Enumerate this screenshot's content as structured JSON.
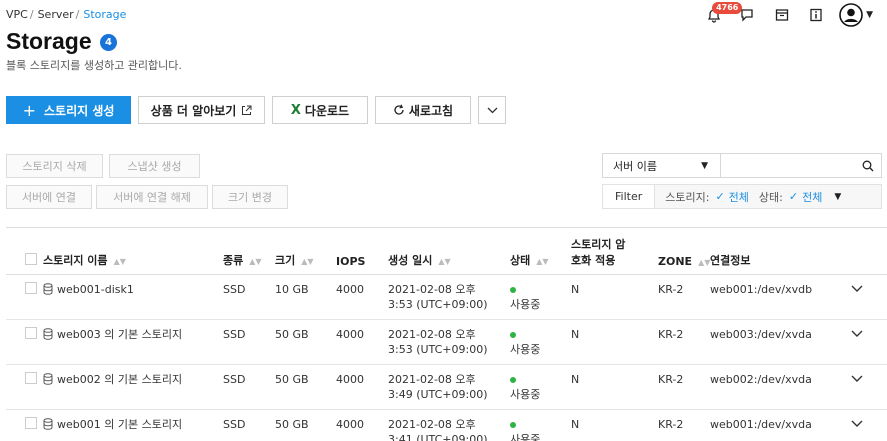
{
  "breadcrumb": {
    "items": [
      "VPC",
      "Server"
    ],
    "current": "Storage"
  },
  "notifications": {
    "count": "4766"
  },
  "page": {
    "title": "Storage",
    "count": "4",
    "subtitle": "블록 스토리지를 생성하고 관리합니다."
  },
  "actions": {
    "create": "스토리지 생성",
    "learn_more": "상품 더 알아보기",
    "download": "다운로드",
    "refresh": "새로고침"
  },
  "row_actions": {
    "delete": "스토리지 삭제",
    "snapshot": "스냅샷 생성",
    "attach": "서버에 연결",
    "detach": "서버에 연결 해제",
    "resize": "크기 변경"
  },
  "search": {
    "field": "서버 이름",
    "value": ""
  },
  "filter": {
    "label": "Filter",
    "storage_label": "스토리지:",
    "storage_value": "전체",
    "status_label": "상태:",
    "status_value": "전체"
  },
  "table": {
    "columns": {
      "name": "스토리지 이름",
      "type": "종류",
      "size": "크기",
      "iops": "IOPS",
      "created": "생성 일시",
      "status": "상태",
      "encryption_line1": "스토리지 암",
      "encryption_line2": "호화 적용",
      "zone": "ZONE",
      "connection": "연결정보"
    },
    "rows": [
      {
        "name": "web001-disk1",
        "type": "SSD",
        "size": "10 GB",
        "iops": "4000",
        "created_line1": "2021-02-08 오후",
        "created_line2": "3:53 (UTC+09:00)",
        "status": "사용중",
        "encryption": "N",
        "zone": "KR-2",
        "connection": "web001:/dev/xvdb"
      },
      {
        "name": "web003 의 기본 스토리지",
        "type": "SSD",
        "size": "50 GB",
        "iops": "4000",
        "created_line1": "2021-02-08 오후",
        "created_line2": "3:53 (UTC+09:00)",
        "status": "사용중",
        "encryption": "N",
        "zone": "KR-2",
        "connection": "web003:/dev/xvda"
      },
      {
        "name": "web002 의 기본 스토리지",
        "type": "SSD",
        "size": "50 GB",
        "iops": "4000",
        "created_line1": "2021-02-08 오후",
        "created_line2": "3:49 (UTC+09:00)",
        "status": "사용중",
        "encryption": "N",
        "zone": "KR-2",
        "connection": "web002:/dev/xvda"
      },
      {
        "name": "web001 의 기본 스토리지",
        "type": "SSD",
        "size": "50 GB",
        "iops": "4000",
        "created_line1": "2021-02-08 오후",
        "created_line2": "3:41 (UTC+09:00)",
        "status": "사용중",
        "encryption": "N",
        "zone": "KR-2",
        "connection": "web001:/dev/xvda"
      }
    ]
  },
  "colors": {
    "accent": "#1a8fe3",
    "status_green": "#2fb344",
    "badge_red": "#e84b3c"
  },
  "icons": [
    "bell-icon",
    "chat-icon",
    "calendar-icon",
    "info-icon",
    "user-avatar-icon",
    "search-icon",
    "external-link-icon",
    "excel-icon",
    "refresh-icon",
    "chevron-down-icon",
    "disk-icon",
    "sort-icon"
  ]
}
